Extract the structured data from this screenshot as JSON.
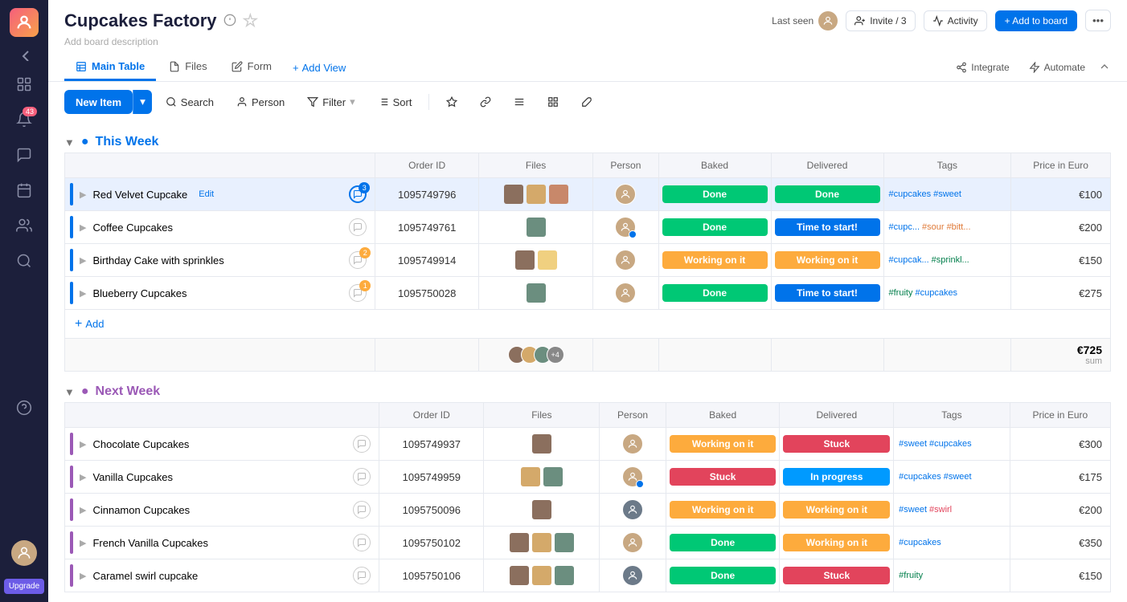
{
  "sidebar": {
    "logo": "M",
    "icons": [
      "apps",
      "bell",
      "chat",
      "calendar",
      "people",
      "search",
      "question"
    ],
    "notification_count": "43",
    "upgrade": "Upgrade"
  },
  "header": {
    "board_title": "Cupcakes Factory",
    "board_desc": "Add board description",
    "last_seen_label": "Last seen",
    "invite_label": "Invite / 3",
    "activity_label": "Activity",
    "add_to_board_label": "+ Add to board"
  },
  "tabs": [
    {
      "label": "Main Table",
      "active": true
    },
    {
      "label": "Files",
      "active": false
    },
    {
      "label": "Form",
      "active": false
    }
  ],
  "tab_actions": {
    "add_view": "+ Add View",
    "integrate": "Integrate",
    "automate": "Automate"
  },
  "toolbar": {
    "new_item": "New Item",
    "search": "Search",
    "person": "Person",
    "filter": "Filter",
    "sort": "Sort"
  },
  "groups": [
    {
      "id": "this-week",
      "title": "This Week",
      "color": "#0073ea",
      "columns": [
        "Order ID",
        "Files",
        "Person",
        "Baked",
        "Delivered",
        "Tags",
        "Price in Euro"
      ],
      "rows": [
        {
          "name": "Red Velvet Cupcake",
          "color": "#0073ea",
          "order_id": "1095749796",
          "files_count": 3,
          "person_colors": [
            "#c8a882"
          ],
          "baked": {
            "label": "Done",
            "type": "done"
          },
          "delivered": {
            "label": "Done",
            "type": "done"
          },
          "tags": [
            "#cupcakes",
            "#sweet"
          ],
          "tags_colors": [
            "blue",
            "blue"
          ],
          "price": "€100",
          "notif": "3",
          "selected": true
        },
        {
          "name": "Coffee Cupcakes",
          "color": "#0073ea",
          "order_id": "1095749761",
          "files_count": 1,
          "person_colors": [
            "#c8a882"
          ],
          "baked": {
            "label": "Done",
            "type": "done"
          },
          "delivered": {
            "label": "Time to start!",
            "type": "time"
          },
          "tags": [
            "#cupc...",
            "#sour",
            "#bitt..."
          ],
          "tags_colors": [
            "blue",
            "orange",
            "orange"
          ],
          "price": "€200"
        },
        {
          "name": "Birthday Cake with sprinkles",
          "color": "#0073ea",
          "order_id": "1095749914",
          "files_count": 2,
          "person_colors": [
            "#c8a882"
          ],
          "baked": {
            "label": "Working on it",
            "type": "working"
          },
          "delivered": {
            "label": "Working on it",
            "type": "working"
          },
          "tags": [
            "#cupcak...",
            "#sprinkl..."
          ],
          "tags_colors": [
            "blue",
            "green"
          ],
          "price": "€150",
          "notif": "2"
        },
        {
          "name": "Blueberry Cupcakes",
          "color": "#0073ea",
          "order_id": "1095750028",
          "files_count": 1,
          "person_colors": [
            "#c8a882"
          ],
          "baked": {
            "label": "Done",
            "type": "done"
          },
          "delivered": {
            "label": "Time to start!",
            "type": "time"
          },
          "tags": [
            "#fruity",
            "#cupcakes"
          ],
          "tags_colors": [
            "green",
            "blue"
          ],
          "price": "€275",
          "notif": "1"
        }
      ],
      "summary_price": "€725",
      "summary_label": "sum",
      "avatar_count": "+4"
    }
  ],
  "groups2": [
    {
      "id": "next-week",
      "title": "Next Week",
      "color": "#9b59b6",
      "columns": [
        "Order ID",
        "Files",
        "Person",
        "Baked",
        "Delivered",
        "Tags",
        "Price in Euro"
      ],
      "rows": [
        {
          "name": "Chocolate Cupcakes",
          "color": "#9b59b6",
          "order_id": "1095749937",
          "files_count": 1,
          "person_colors": [
            "#c8a882"
          ],
          "baked": {
            "label": "Working on it",
            "type": "working"
          },
          "delivered": {
            "label": "Stuck",
            "type": "stuck"
          },
          "tags": [
            "#sweet",
            "#cupcakes"
          ],
          "tags_colors": [
            "blue",
            "blue"
          ],
          "price": "€300"
        },
        {
          "name": "Vanilla Cupcakes",
          "color": "#9b59b6",
          "order_id": "1095749959",
          "files_count": 2,
          "person_colors": [
            "#c8a882"
          ],
          "baked": {
            "label": "Stuck",
            "type": "stuck"
          },
          "delivered": {
            "label": "In progress",
            "type": "inprog"
          },
          "tags": [
            "#cupcakes",
            "#sweet"
          ],
          "tags_colors": [
            "blue",
            "blue"
          ],
          "price": "€175"
        },
        {
          "name": "Cinnamon Cupcakes",
          "color": "#9b59b6",
          "order_id": "1095750096",
          "files_count": 1,
          "person_colors": [
            "#6c7a89"
          ],
          "baked": {
            "label": "Working on it",
            "type": "working"
          },
          "delivered": {
            "label": "Working on it",
            "type": "working"
          },
          "tags": [
            "#sweet",
            "#swirl"
          ],
          "tags_colors": [
            "blue",
            "pink"
          ],
          "price": "€200"
        },
        {
          "name": "French Vanilla Cupcakes",
          "color": "#9b59b6",
          "order_id": "1095750102",
          "files_count": 3,
          "person_colors": [
            "#c8a882"
          ],
          "baked": {
            "label": "Done",
            "type": "done"
          },
          "delivered": {
            "label": "Working on it",
            "type": "working"
          },
          "tags": [
            "#cupcakes"
          ],
          "tags_colors": [
            "blue"
          ],
          "price": "€350"
        },
        {
          "name": "Caramel swirl cupcake",
          "color": "#9b59b6",
          "order_id": "1095750106",
          "files_count": 3,
          "person_colors": [
            "#6c7a89"
          ],
          "baked": {
            "label": "Done",
            "type": "done"
          },
          "delivered": {
            "label": "Stuck",
            "type": "stuck"
          },
          "tags": [
            "#fruity"
          ],
          "tags_colors": [
            "green"
          ],
          "price": "€150"
        }
      ]
    }
  ]
}
